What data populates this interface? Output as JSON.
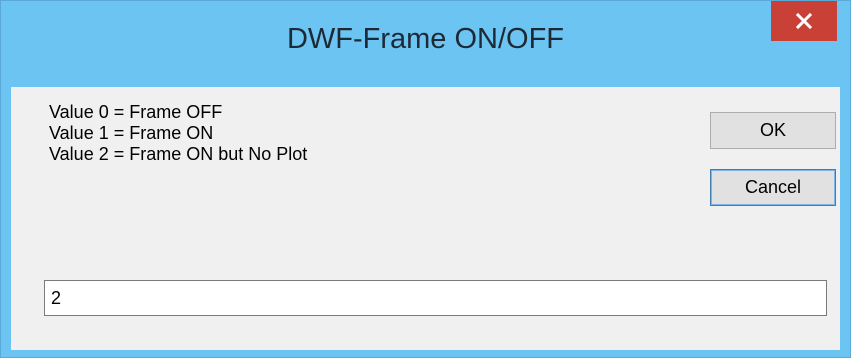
{
  "dialog": {
    "title": "DWF-Frame ON/OFF",
    "close_icon": "close-icon",
    "prompt_lines": [
      "Value 0 = Frame OFF",
      "Value 1 = Frame ON",
      "Value 2 = Frame ON but No Plot"
    ],
    "ok_label": "OK",
    "cancel_label": "Cancel",
    "input_value": "2"
  },
  "colors": {
    "titlebar": "#6cc4f2",
    "close_button": "#c94036",
    "client_background": "#f0f0f0"
  }
}
